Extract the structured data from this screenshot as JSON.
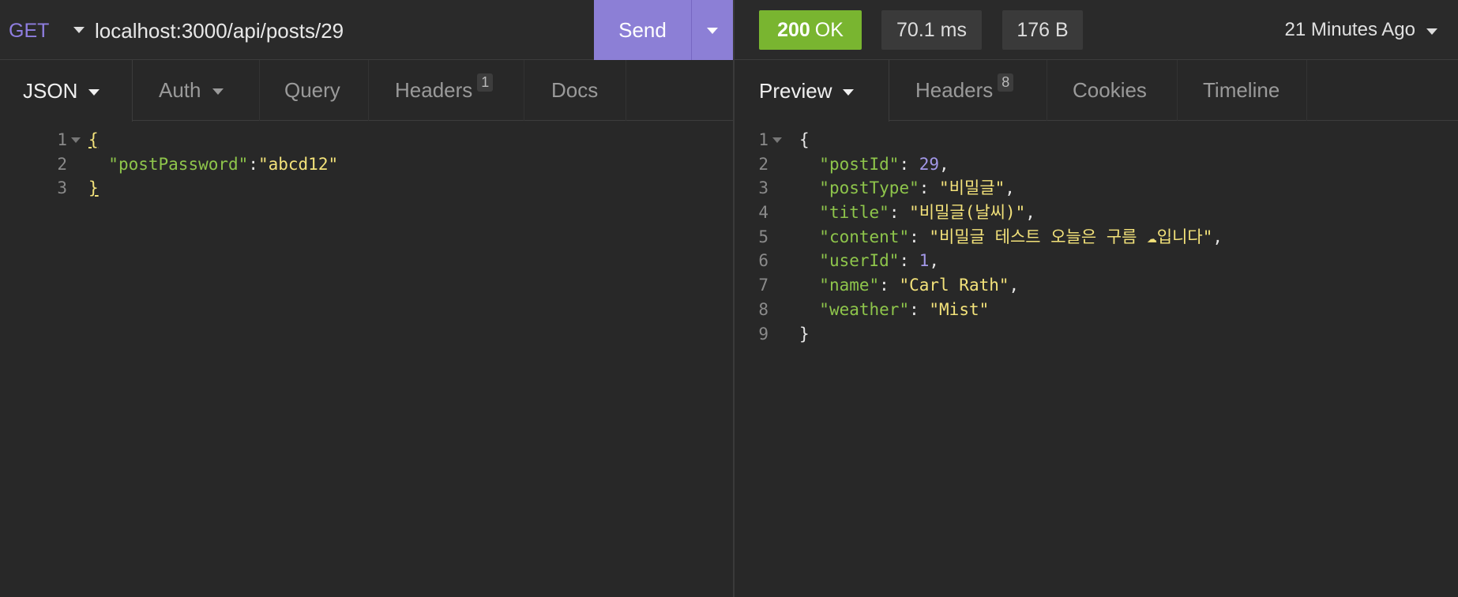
{
  "request": {
    "method": "GET",
    "url": "localhost:3000/api/posts/29",
    "send_label": "Send",
    "tabs": [
      {
        "label": "JSON",
        "active": true,
        "caret": true
      },
      {
        "label": "Auth",
        "caret": true
      },
      {
        "label": "Query"
      },
      {
        "label": "Headers",
        "badge": "1"
      },
      {
        "label": "Docs"
      }
    ],
    "body_lines": [
      {
        "num": "1",
        "fold": true,
        "tokens": [
          {
            "t": "p",
            "v": "{"
          }
        ]
      },
      {
        "num": "2",
        "tokens": [
          {
            "t": "p",
            "v": "  "
          },
          {
            "t": "k",
            "v": "\"postPassword\""
          },
          {
            "t": "p",
            "v": ":"
          },
          {
            "t": "s",
            "v": "\"abcd12\""
          }
        ]
      },
      {
        "num": "3",
        "tokens": [
          {
            "t": "p",
            "v": "}"
          }
        ]
      }
    ]
  },
  "response": {
    "status_code": "200",
    "status_text": "OK",
    "time": "70.1 ms",
    "size": "176 B",
    "received": "21 Minutes Ago",
    "tabs": [
      {
        "label": "Preview",
        "active": true,
        "caret": true
      },
      {
        "label": "Headers",
        "badge": "8"
      },
      {
        "label": "Cookies"
      },
      {
        "label": "Timeline"
      }
    ],
    "body_lines": [
      {
        "num": "1",
        "fold": true,
        "tokens": [
          {
            "t": "p",
            "v": "{"
          }
        ]
      },
      {
        "num": "2",
        "tokens": [
          {
            "t": "p",
            "v": "  "
          },
          {
            "t": "k",
            "v": "\"postId\""
          },
          {
            "t": "p",
            "v": ": "
          },
          {
            "t": "n",
            "v": "29"
          },
          {
            "t": "p",
            "v": ","
          }
        ]
      },
      {
        "num": "3",
        "tokens": [
          {
            "t": "p",
            "v": "  "
          },
          {
            "t": "k",
            "v": "\"postType\""
          },
          {
            "t": "p",
            "v": ": "
          },
          {
            "t": "s",
            "v": "\"비밀글\""
          },
          {
            "t": "p",
            "v": ","
          }
        ]
      },
      {
        "num": "4",
        "tokens": [
          {
            "t": "p",
            "v": "  "
          },
          {
            "t": "k",
            "v": "\"title\""
          },
          {
            "t": "p",
            "v": ": "
          },
          {
            "t": "s",
            "v": "\"비밀글(날씨)\""
          },
          {
            "t": "p",
            "v": ","
          }
        ]
      },
      {
        "num": "5",
        "tokens": [
          {
            "t": "p",
            "v": "  "
          },
          {
            "t": "k",
            "v": "\"content\""
          },
          {
            "t": "p",
            "v": ": "
          },
          {
            "t": "s",
            "v": "\"비밀글 테스트 오늘은 구름 ☁입니다\""
          },
          {
            "t": "p",
            "v": ","
          }
        ]
      },
      {
        "num": "6",
        "tokens": [
          {
            "t": "p",
            "v": "  "
          },
          {
            "t": "k",
            "v": "\"userId\""
          },
          {
            "t": "p",
            "v": ": "
          },
          {
            "t": "n",
            "v": "1"
          },
          {
            "t": "p",
            "v": ","
          }
        ]
      },
      {
        "num": "7",
        "tokens": [
          {
            "t": "p",
            "v": "  "
          },
          {
            "t": "k",
            "v": "\"name\""
          },
          {
            "t": "p",
            "v": ": "
          },
          {
            "t": "s",
            "v": "\"Carl Rath\""
          },
          {
            "t": "p",
            "v": ","
          }
        ]
      },
      {
        "num": "8",
        "tokens": [
          {
            "t": "p",
            "v": "  "
          },
          {
            "t": "k",
            "v": "\"weather\""
          },
          {
            "t": "p",
            "v": ": "
          },
          {
            "t": "s",
            "v": "\"Mist\""
          }
        ]
      },
      {
        "num": "9",
        "tokens": [
          {
            "t": "p",
            "v": "}"
          }
        ]
      }
    ]
  },
  "colors": {
    "accent": "#8c7fd6",
    "status_ok": "#79b530",
    "json_key": "#8ec54b",
    "json_string": "#f3e27a",
    "json_number": "#a398e8"
  },
  "icons": [
    "method-caret-icon",
    "send-dropdown-caret-icon",
    "tab-caret-icon",
    "fold-caret-icon",
    "received-caret-icon"
  ]
}
